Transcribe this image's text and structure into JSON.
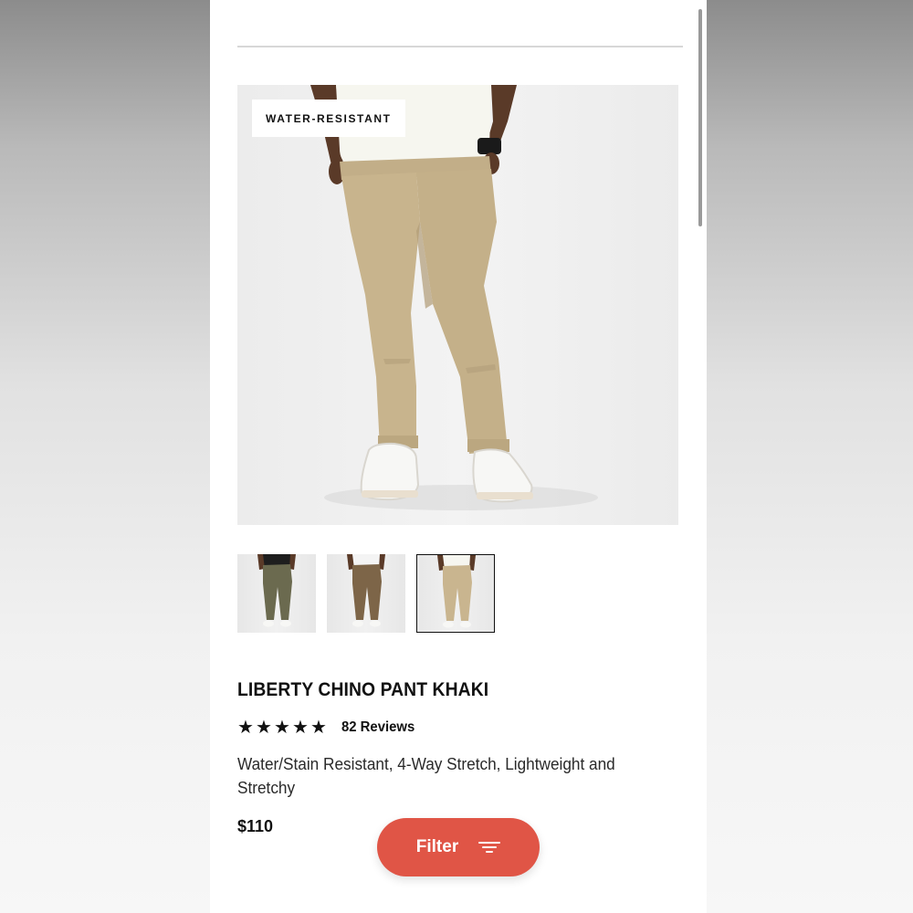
{
  "product": {
    "badge": "WATER-RESISTANT",
    "title": "LIBERTY CHINO PANT KHAKI",
    "rating": 5,
    "reviews_label": "82 Reviews",
    "description": "Water/Stain Resistant, 4-Way Stretch, Lightweight and Stretchy",
    "price": "$110",
    "thumbnails": [
      {
        "color_name": "olive",
        "pant_color": "#6b6a4f",
        "shirt_color": "#1e1e1e",
        "selected": false
      },
      {
        "color_name": "brown",
        "pant_color": "#7d6548",
        "shirt_color": "#f4f4f4",
        "selected": false
      },
      {
        "color_name": "khaki",
        "pant_color": "#c9b58f",
        "shirt_color": "#f6f6f0",
        "selected": true
      }
    ]
  },
  "filter_button": {
    "label": "Filter",
    "icon": "filter-lines-icon",
    "color": "#e05546"
  },
  "colors": {
    "pants": "#c8b48d",
    "shirt": "#f6f6ef",
    "skin": "#5a3a28",
    "shoes": "#f7f7f5"
  }
}
